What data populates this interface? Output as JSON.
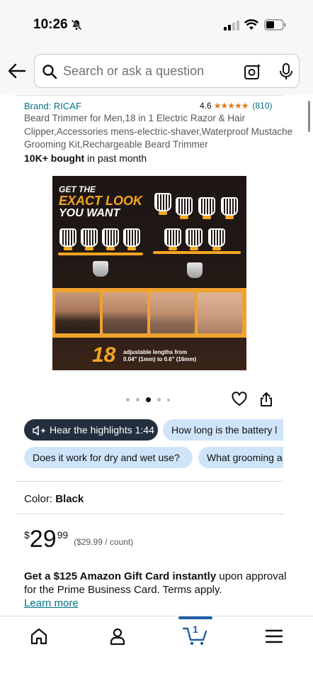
{
  "status_bar": {
    "time": "10:26"
  },
  "search": {
    "placeholder": "Search or ask a question"
  },
  "product": {
    "brand": "Brand: RICAF",
    "rating": "4.6",
    "stars": "★★★★★",
    "rating_count": "(810)",
    "title": "Beard Trimmer for Men,18 in 1 Electric Razor & Hair Clipper,Accessories mens-electric-shaver,Waterproof Mustache Grooming Kit,Rechargeable Beard Trimmer",
    "bought_bold": "10K+ bought",
    "bought_rest": " in past month"
  },
  "image": {
    "line1": "GET THE",
    "line2": "EXACT LOOK",
    "line3": "YOU WANT",
    "big_number": "18",
    "caption_line1": "adjustable lengths from",
    "caption_line2": "0.04\" (1mm) to 0.6\" (16mm)",
    "accent_color": "#f5a623"
  },
  "carousel": {
    "dot_count": 5,
    "active_index": 2
  },
  "chips": {
    "highlights": "Hear the highlights 1:44",
    "q_battery": "How long is the battery l",
    "q_dry_wet": "Does it work for dry and wet use?",
    "q_grooming": "What grooming a"
  },
  "color": {
    "label": "Color:",
    "value": "Black"
  },
  "price": {
    "symbol": "$",
    "whole": "29",
    "fraction": "99",
    "unit": "($29.99 / count)"
  },
  "promo": {
    "bold": "Get a $125 Amazon Gift Card instantly",
    "rest": " upon approval for the Prime Business Card. Terms apply.",
    "link": "Learn more"
  },
  "bottom_nav": {
    "cart_count": "1"
  },
  "colors": {
    "link": "#007185",
    "star": "#de7921",
    "chip_light": "#cfe4f9",
    "chip_dark": "#232f3e"
  }
}
